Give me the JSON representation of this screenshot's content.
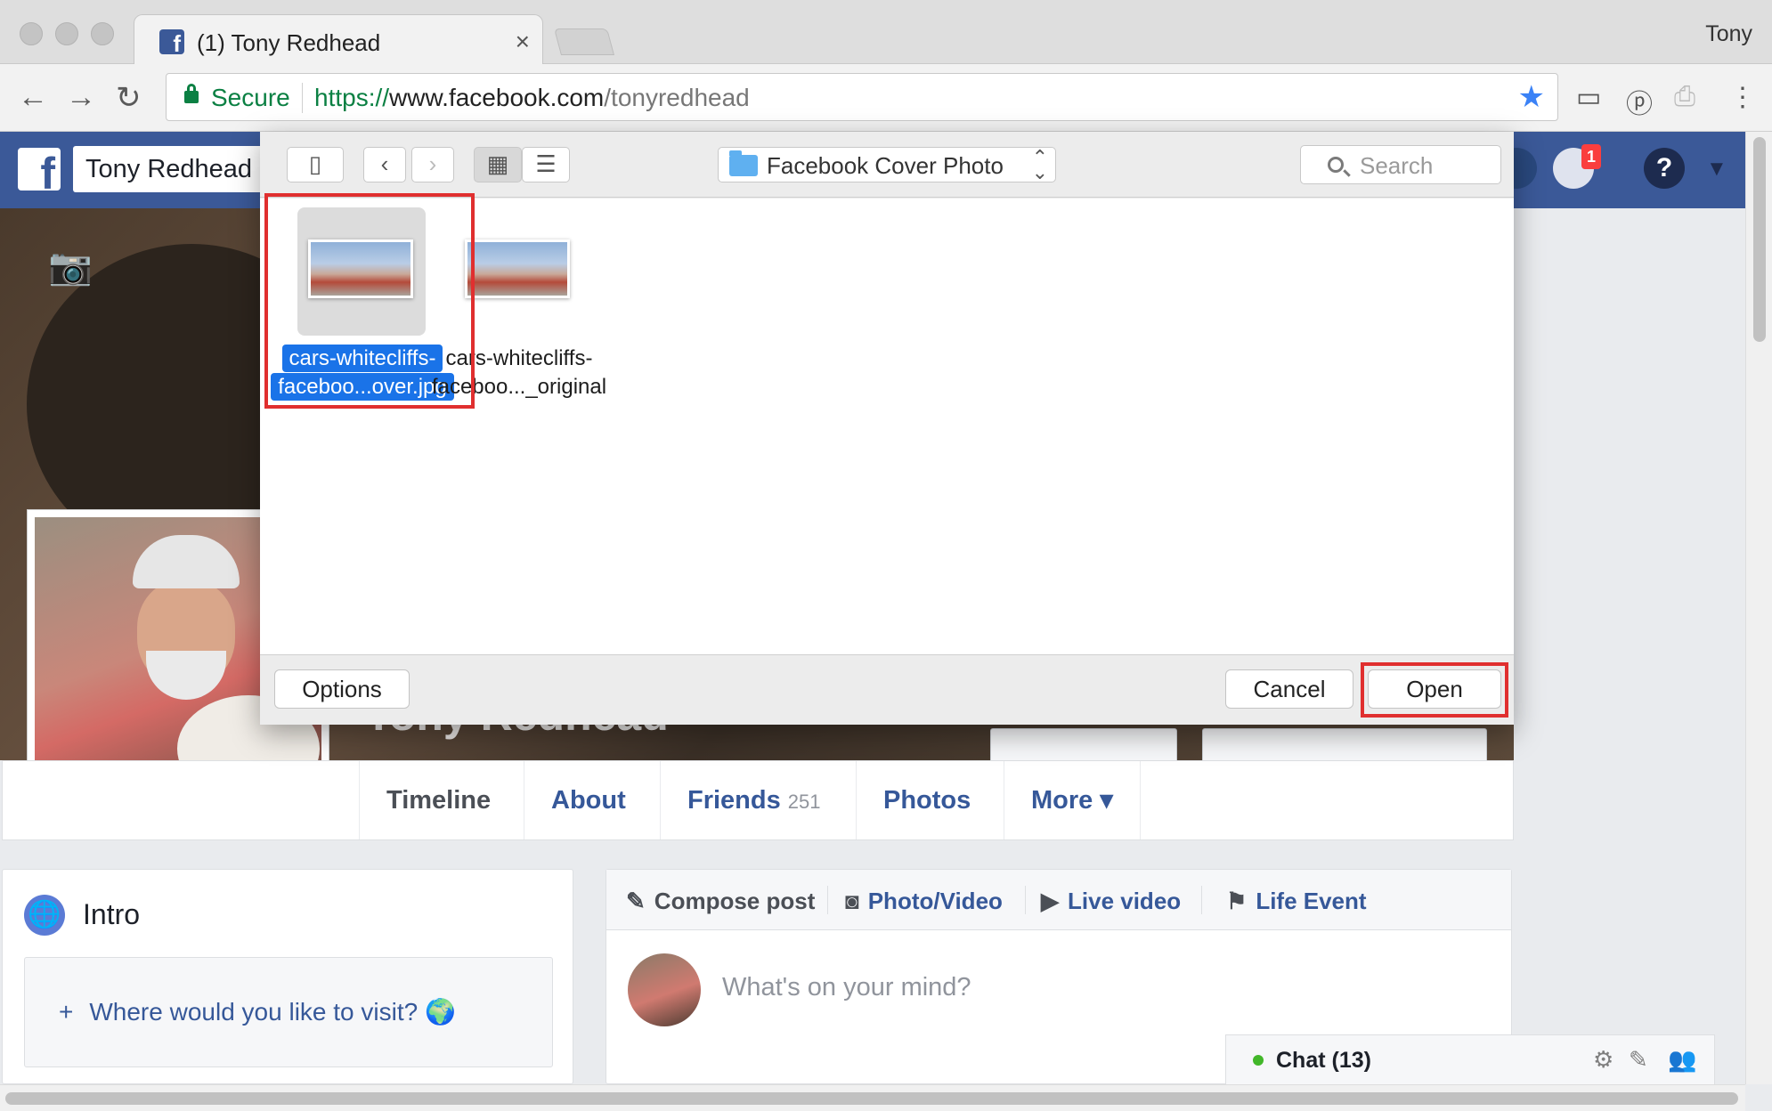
{
  "browser": {
    "tab_title": "(1) Tony Redhead",
    "tab_close": "×",
    "profile_name": "Tony",
    "secure_label": "Secure",
    "url_scheme": "https://",
    "url_host": "www.facebook.com",
    "url_path": "/tonyredhead"
  },
  "facebook": {
    "search_value": "Tony Redhead",
    "notification_count": "1",
    "cover_name": "Tony Redhead",
    "tabs": [
      {
        "label": "Timeline"
      },
      {
        "label": "About"
      },
      {
        "label": "Friends",
        "count": "251"
      },
      {
        "label": "Photos"
      },
      {
        "label": "More ▾"
      }
    ],
    "intro": {
      "title": "Intro",
      "visit_prompt": "Where would you like to visit? 🌍"
    },
    "composer": {
      "tabs": [
        "Compose post",
        "Photo/Video",
        "Live video",
        "Life Event"
      ],
      "placeholder": "What's on your mind?"
    },
    "chat": {
      "label": "Chat (13)"
    }
  },
  "file_dialog": {
    "folder_name": "Facebook Cover Photo",
    "search_placeholder": "Search",
    "files": [
      {
        "line1": "cars-whitecliffs-",
        "line2": "faceboo...over.jpg",
        "selected": true
      },
      {
        "line1": "cars-whitecliffs-",
        "line2": "faceboo..._original",
        "selected": false
      }
    ],
    "options_label": "Options",
    "cancel_label": "Cancel",
    "open_label": "Open"
  },
  "colors": {
    "facebook_blue": "#3b5998",
    "link_blue": "#365899",
    "selection_blue": "#1a73e8",
    "highlight_red": "#e02f2f",
    "secure_green": "#0b8043"
  }
}
